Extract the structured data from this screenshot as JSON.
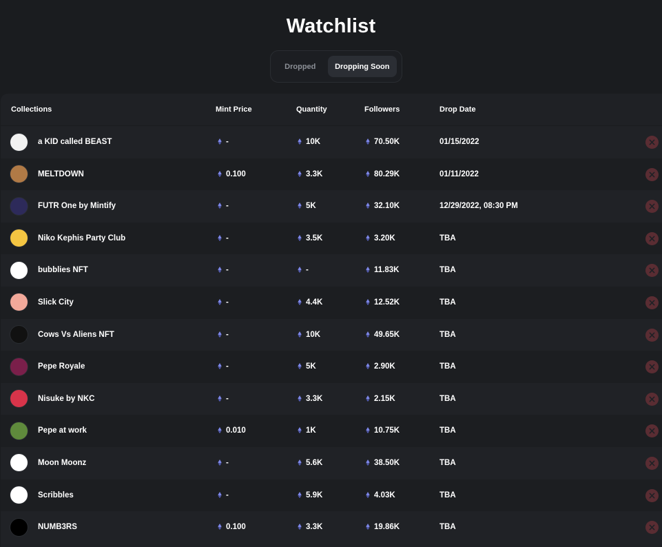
{
  "page": {
    "title": "Watchlist"
  },
  "tabs": [
    {
      "label": "Dropped",
      "active": false
    },
    {
      "label": "Dropping Soon",
      "active": true
    }
  ],
  "table": {
    "columns": [
      "Collections",
      "Mint Price",
      "Quantity",
      "Followers",
      "Drop Date"
    ],
    "rows": [
      {
        "name": "a KID called BEAST",
        "mint": "-",
        "qty": "10K",
        "followers": "70.50K",
        "date": "01/15/2022",
        "avatar_color": "#f2f2f2"
      },
      {
        "name": "MELTDOWN",
        "mint": "0.100",
        "qty": "3.3K",
        "followers": "80.29K",
        "date": "01/11/2022",
        "avatar_color": "#b07a46"
      },
      {
        "name": "FUTR One by Mintify",
        "mint": "-",
        "qty": "5K",
        "followers": "32.10K",
        "date": "12/29/2022, 08:30 PM",
        "avatar_color": "#2d2a5a"
      },
      {
        "name": "Niko Kephis Party Club",
        "mint": "-",
        "qty": "3.5K",
        "followers": "3.20K",
        "date": "TBA",
        "avatar_color": "#f4c542"
      },
      {
        "name": "bubblies NFT",
        "mint": "-",
        "qty": "-",
        "followers": "11.83K",
        "date": "TBA",
        "avatar_color": "#ffffff"
      },
      {
        "name": "Slick City",
        "mint": "-",
        "qty": "4.4K",
        "followers": "12.52K",
        "date": "TBA",
        "avatar_color": "#f2a99a"
      },
      {
        "name": "Cows Vs Aliens NFT",
        "mint": "-",
        "qty": "10K",
        "followers": "49.65K",
        "date": "TBA",
        "avatar_color": "#111111"
      },
      {
        "name": "Pepe Royale",
        "mint": "-",
        "qty": "5K",
        "followers": "2.90K",
        "date": "TBA",
        "avatar_color": "#7a1f4a"
      },
      {
        "name": "Nisuke by NKC",
        "mint": "-",
        "qty": "3.3K",
        "followers": "2.15K",
        "date": "TBA",
        "avatar_color": "#d8344a"
      },
      {
        "name": "Pepe at work",
        "mint": "0.010",
        "qty": "1K",
        "followers": "10.75K",
        "date": "TBA",
        "avatar_color": "#5f8a3c"
      },
      {
        "name": "Moon Moonz",
        "mint": "-",
        "qty": "5.6K",
        "followers": "38.50K",
        "date": "TBA",
        "avatar_color": "#ffffff"
      },
      {
        "name": "Scribbles",
        "mint": "-",
        "qty": "5.9K",
        "followers": "4.03K",
        "date": "TBA",
        "avatar_color": "#ffffff"
      },
      {
        "name": "NUMB3RS",
        "mint": "0.100",
        "qty": "3.3K",
        "followers": "19.86K",
        "date": "TBA",
        "avatar_color": "#000000"
      }
    ]
  },
  "icons": {
    "currency": "eth-icon",
    "remove": "close-icon"
  },
  "colors": {
    "eth_icon": "#7c86e8",
    "remove_bg": "#5a2d33",
    "remove_x": "#1f2125"
  }
}
